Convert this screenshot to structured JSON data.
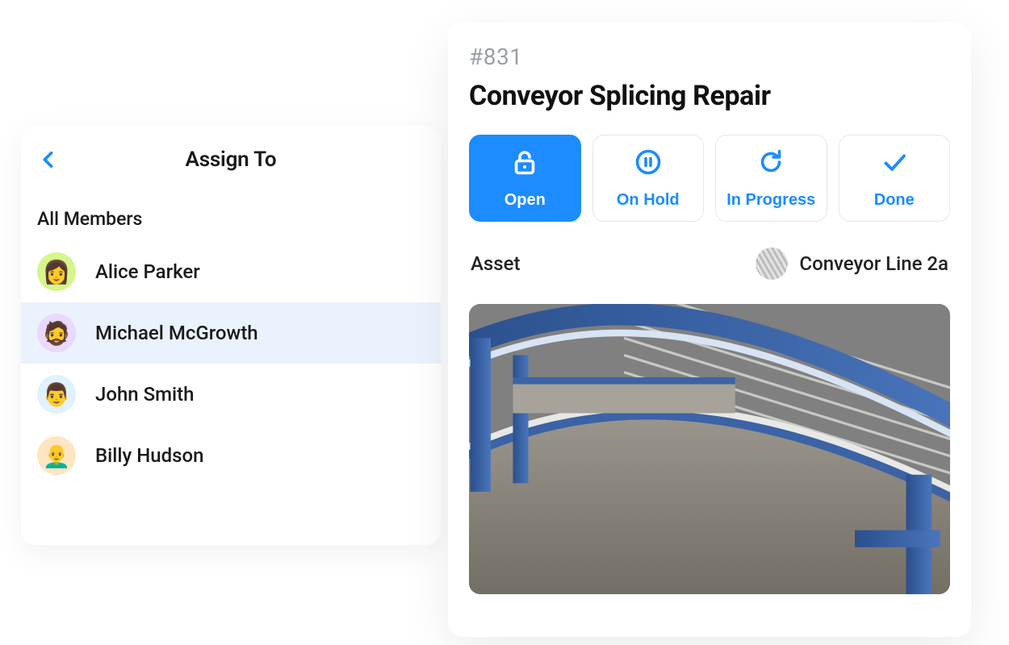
{
  "assign": {
    "title": "Assign To",
    "section_label": "All Members",
    "selected_index": 1,
    "members": [
      {
        "name": "Alice Parker",
        "color": "#d6f58a",
        "emoji": "👩"
      },
      {
        "name": "Michael McGrowth",
        "color": "#e9d8ff",
        "emoji": "🧔"
      },
      {
        "name": "John Smith",
        "color": "#e0f1ff",
        "emoji": "👨"
      },
      {
        "name": "Billy Hudson",
        "color": "#ffe5c2",
        "emoji": "👨‍🦲"
      }
    ]
  },
  "ticket": {
    "id": "#831",
    "title": "Conveyor Splicing Repair",
    "status_active": "Open",
    "statuses": [
      {
        "key": "Open",
        "label": "Open",
        "icon": "unlock-icon"
      },
      {
        "key": "On Hold",
        "label": "On Hold",
        "icon": "pause-icon"
      },
      {
        "key": "In Progress",
        "label": "In Progress",
        "icon": "cycle-icon"
      },
      {
        "key": "Done",
        "label": "Done",
        "icon": "check-icon"
      }
    ],
    "asset": {
      "label": "Asset",
      "name": "Conveyor Line 2a"
    }
  }
}
